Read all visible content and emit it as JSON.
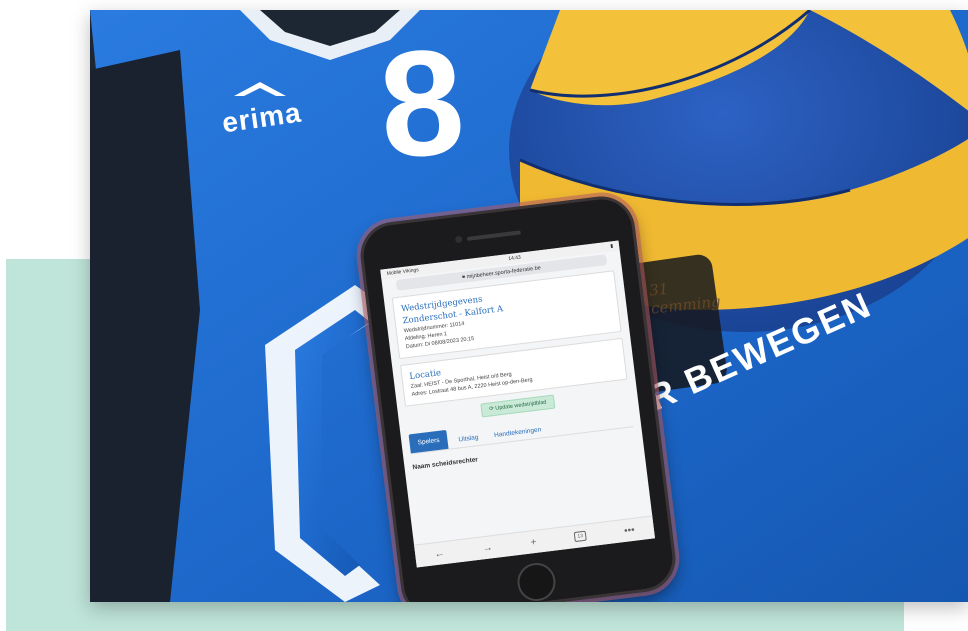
{
  "jersey": {
    "brand": "erima",
    "number": "8",
    "slogan": "ER BEWEGEN"
  },
  "ball": {
    "handwriting": "31 \ncemming"
  },
  "phone": {
    "status": {
      "carrier": "Mobile Vikings",
      "time": "14:43"
    },
    "url": "mijnbeheer.sporta-federatie.be",
    "match_card": {
      "title": "Wedstrijdgegevens",
      "teams": "Zonderschot - Kalfort A",
      "match_number": "Wedstrijdnummer: 11014",
      "division": "Afdeling: Heren 1",
      "date": "Datum: Di 08/08/2023 20:15"
    },
    "location_card": {
      "title": "Locatie",
      "hall": "Zaal: HEIST - De Sporthal, Heist o/d Berg",
      "address": "Adres: Lostraat 48 bus A, 2220 Heist op-den-Berg"
    },
    "update_button": "Update wedstrijdblad",
    "tabs": [
      "Spelers",
      "Uitslag",
      "Handtekeningen"
    ],
    "section_label": "Naam scheidsrechter",
    "browser_nav": {
      "back": "←",
      "forward": "→",
      "new_tab": "+",
      "tab_count": "13",
      "more": "•••"
    }
  },
  "colors": {
    "jersey_blue": "#1f6fd0",
    "mint_background": "#bfe4d9",
    "ball_yellow": "#f3c23a",
    "ball_blue": "#1f4ea8"
  }
}
